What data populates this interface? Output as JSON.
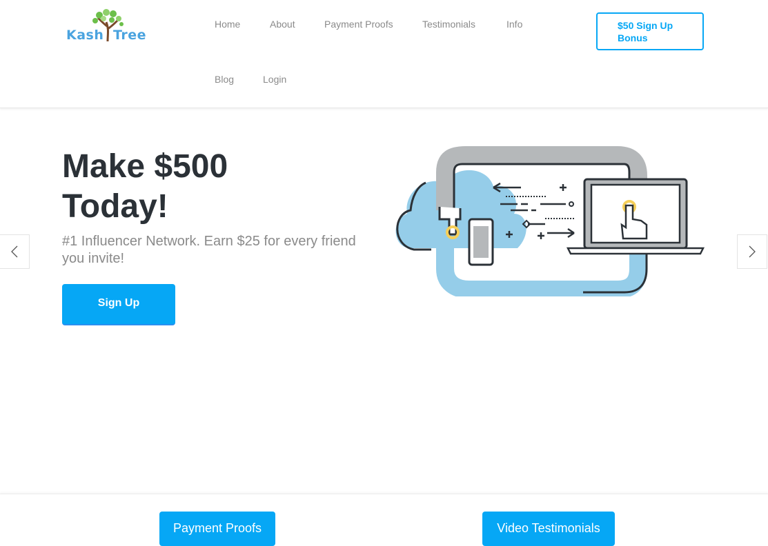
{
  "brand": {
    "name_left": "Kash",
    "name_right": "Tree"
  },
  "nav": {
    "items": [
      {
        "label": "Home"
      },
      {
        "label": "About"
      },
      {
        "label": "Payment Proofs"
      },
      {
        "label": "Testimonials"
      },
      {
        "label": "Info"
      },
      {
        "label": "Blog"
      },
      {
        "label": "Login"
      }
    ],
    "bonus_button": "$50 Sign Up Bonus"
  },
  "hero": {
    "title_line1": "Make $500",
    "title_line2": "Today!",
    "subtitle": "#1 Influencer Network. Earn $25 for every friend you invite!",
    "signup_button": "Sign Up",
    "illustration_icon": "cloud-devices-sync-illustration"
  },
  "carousel": {
    "prev_icon": "chevron-left-icon",
    "next_icon": "chevron-right-icon"
  },
  "actions": [
    {
      "label": "Payment Proofs"
    },
    {
      "label": "Video Testimonials"
    }
  ],
  "colors": {
    "accent": "#06a7f5",
    "heading": "#2b3137",
    "muted": "#8a8a8a",
    "cloud": "#95cde9",
    "pipe": "#b5b8ba"
  }
}
